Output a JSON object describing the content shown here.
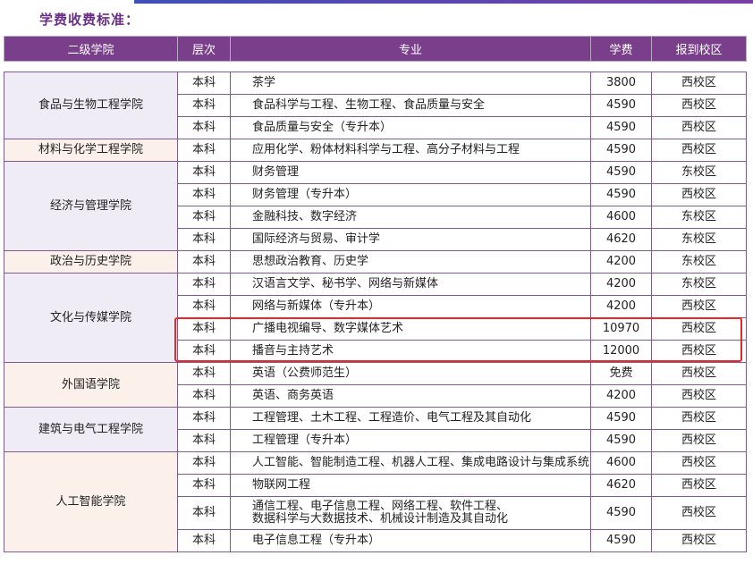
{
  "heading": "学费收费标准：",
  "colors": {
    "header_bg": "#7a3f8a",
    "title": "#6b2d86",
    "highlight": "#e8282b",
    "college_bg": "#f0ecf5"
  },
  "table": {
    "headers": [
      "二级学院",
      "层次",
      "专业",
      "学费",
      "报到校区"
    ],
    "groups": [
      {
        "college": "食品与生物工程学院",
        "rows": [
          {
            "level": "本科",
            "major": "茶学",
            "fee": "3800",
            "campus": "西校区"
          },
          {
            "level": "本科",
            "major": "食品科学与工程、生物工程、食品质量与安全",
            "fee": "4590",
            "campus": "西校区"
          },
          {
            "level": "本科",
            "major": "食品质量与安全（专升本）",
            "fee": "4590",
            "campus": "西校区"
          }
        ]
      },
      {
        "college": "材料与化学工程学院",
        "rows": [
          {
            "level": "本科",
            "major": "应用化学、粉体材料科学与工程、高分子材料与工程",
            "fee": "4590",
            "campus": "西校区"
          }
        ]
      },
      {
        "college": "经济与管理学院",
        "rows": [
          {
            "level": "本科",
            "major": "财务管理",
            "fee": "4590",
            "campus": "东校区"
          },
          {
            "level": "本科",
            "major": "财务管理（专升本）",
            "fee": "4590",
            "campus": "西校区"
          },
          {
            "level": "本科",
            "major": "金融科技、数字经济",
            "fee": "4600",
            "campus": "东校区"
          },
          {
            "level": "本科",
            "major": "国际经济与贸易、审计学",
            "fee": "4620",
            "campus": "东校区"
          }
        ]
      },
      {
        "college": "政治与历史学院",
        "rows": [
          {
            "level": "本科",
            "major": "思想政治教育、历史学",
            "fee": "4200",
            "campus": "东校区"
          }
        ]
      },
      {
        "college": "文化与传媒学院",
        "rows": [
          {
            "level": "本科",
            "major": "汉语言文学、秘书学、网络与新媒体",
            "fee": "4200",
            "campus": "东校区"
          },
          {
            "level": "本科",
            "major": "网络与新媒体（专升本）",
            "fee": "4200",
            "campus": "西校区"
          },
          {
            "level": "本科",
            "major": "广播电视编导、数字媒体艺术",
            "fee": "10970",
            "campus": "西校区"
          },
          {
            "level": "本科",
            "major": "播音与主持艺术",
            "fee": "12000",
            "campus": "西校区"
          }
        ]
      },
      {
        "college": "外国语学院",
        "rows": [
          {
            "level": "本科",
            "major": "英语（公费师范生）",
            "fee": "免费",
            "campus": "西校区"
          },
          {
            "level": "本科",
            "major": "英语、商务英语",
            "fee": "4200",
            "campus": "西校区"
          }
        ]
      },
      {
        "college": "建筑与电气工程学院",
        "rows": [
          {
            "level": "本科",
            "major": "工程管理、土木工程、工程造价、电气工程及其自动化",
            "fee": "4590",
            "campus": "西校区"
          },
          {
            "level": "本科",
            "major": "工程管理（专升本）",
            "fee": "4590",
            "campus": "西校区"
          }
        ]
      },
      {
        "college": "人工智能学院",
        "rows": [
          {
            "level": "本科",
            "major": "人工智能、智能制造工程、机器人工程、集成电路设计与集成系统",
            "fee": "4600",
            "campus": "西校区"
          },
          {
            "level": "本科",
            "major": "物联网工程",
            "fee": "4620",
            "campus": "西校区"
          },
          {
            "level": "本科",
            "major_lines": [
              "通信工程、电子信息工程、网络工程、软件工程、",
              "数据科学与大数据技术、机械设计制造及其自动化"
            ],
            "fee": "4590",
            "campus": "西校区"
          },
          {
            "level": "本科",
            "major": "电子信息工程（专升本）",
            "fee": "4590",
            "campus": "西校区"
          }
        ]
      }
    ]
  }
}
